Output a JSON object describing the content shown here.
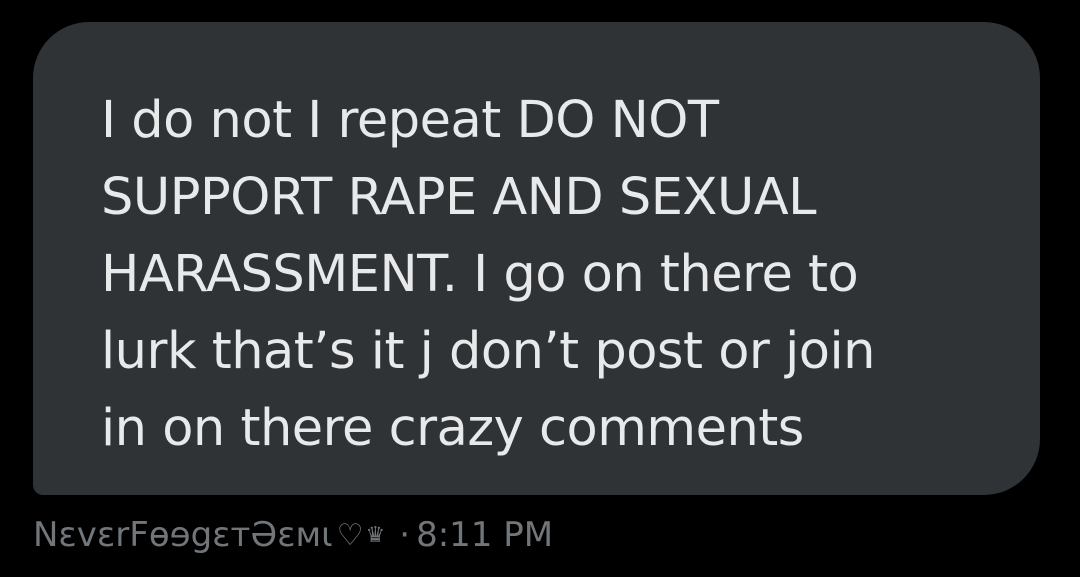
{
  "message": {
    "text": "I do not I repeat DO NOT\nSUPPORT RAPE AND SEXUAL\nHARASSMENT. I go on there to\nlurk that’s it j don’t post or join\nin on there crazy comments"
  },
  "meta": {
    "sender": "NɛvɛrFɵɘgɛтƏɛмι",
    "heart": "♡",
    "crown": "♛",
    "separator": "·",
    "time": "8:11 PM"
  },
  "colors": {
    "background": "#000000",
    "bubble": "#2f3336",
    "text": "#e7e9ea",
    "meta_text": "#71767b"
  }
}
